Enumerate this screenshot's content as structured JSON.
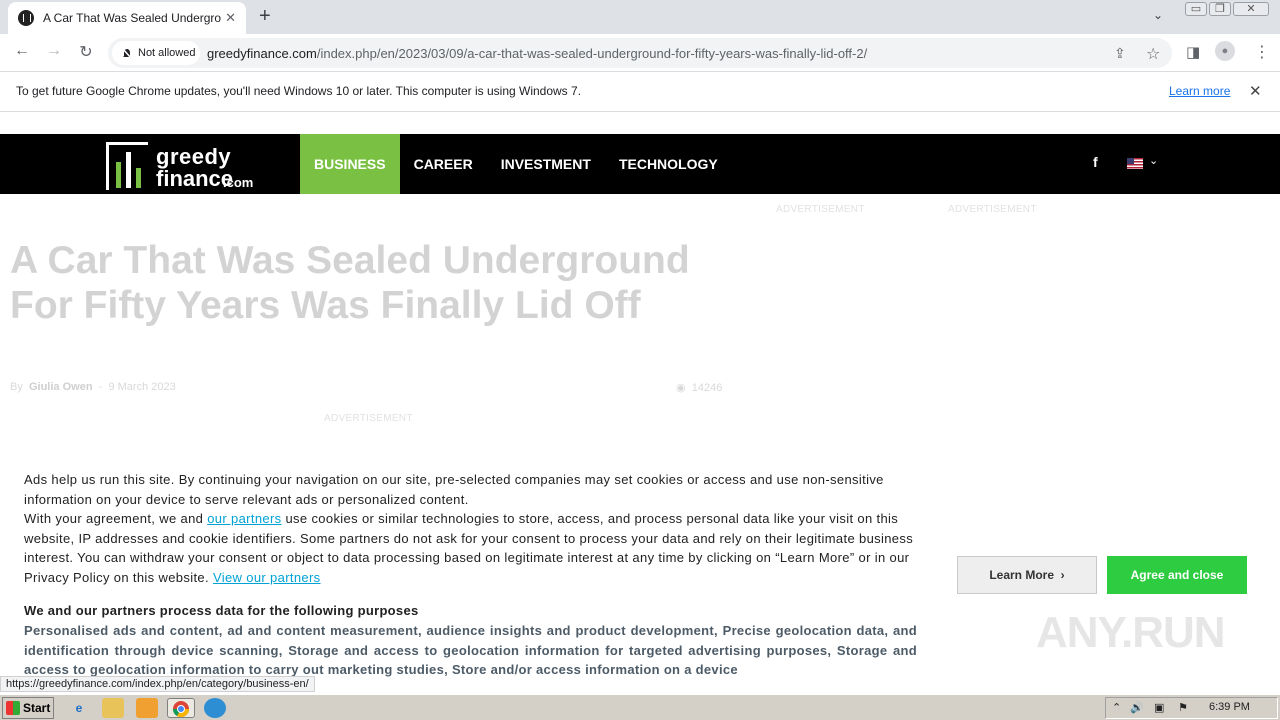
{
  "browser": {
    "tab": {
      "title": "A Car That Was Sealed Underground For Fifty Years Was Finally Lid Off",
      "close": "✕"
    },
    "new_tab": "+",
    "tab_search": "⌄",
    "window_controls": [
      "▭",
      "❐",
      "✕"
    ],
    "toolbar": {
      "back": "←",
      "forward": "→",
      "reload": "↻",
      "site_chip": "Not allowed",
      "url_host": "greedyfinance.com",
      "url_path": "/index.php/en/2023/03/09/a-car-that-was-sealed-underground-for-fifty-years-was-finally-lid-off-2/",
      "share": "⇪",
      "star": "☆",
      "sidepanel": "◨",
      "profile": "●",
      "menu": "⋮"
    },
    "infobar": {
      "message": "To get future Google Chrome updates, you'll need Windows 10 or later. This computer is using Windows 7.",
      "link": "Learn more",
      "close": "✕"
    },
    "status_url": "https://greedyfinance.com/index.php/en/category/business-en/"
  },
  "site": {
    "logo": {
      "line1": "greedy",
      "line2": "finance",
      "suffix": ".com"
    },
    "nav": [
      "BUSINESS",
      "CAREER",
      "INVESTMENT",
      "TECHNOLOGY"
    ],
    "facebook": "f",
    "lang_caret": "⌄"
  },
  "ads": {
    "label": "ADVERTISEMENT"
  },
  "article": {
    "title": "A Car That Was Sealed Underground For Fifty Years Was Finally Lid Off",
    "by": "By",
    "author": "Giulia Owen",
    "separator": "-",
    "date": "9 March 2023",
    "views_icon": "◉",
    "views": "14246"
  },
  "consent": {
    "para1": "Ads help us run this site. By continuing your navigation on our site, pre-selected companies may set cookies or access and use non-sensitive information on your device to serve relevant ads or personalized content.",
    "para2_a": "With your agreement, we and ",
    "para2_link": "our partners",
    "para2_b": " use cookies or similar technologies to store, access, and process personal data like your visit on this website, IP addresses and cookie identifiers. Some partners do not ask for your consent to process your data and rely on their legitimate business interest. You can withdraw your consent or object to data processing based on legitimate interest at any time by clicking on “Learn More” or in our Privacy Policy on this website. ",
    "para2_link2": "View our partners",
    "heading": "We and our partners process data for the following purposes",
    "purposes": "Personalised ads and content, ad and content measurement, audience insights and product development, Precise geolocation data, and identification through device scanning, Storage and access to geolocation information for targeted advertising purposes, Storage and access to geolocation information to carry out marketing studies, Store and/or access information on a device",
    "learn_more": "Learn More",
    "learn_more_arrow": "›",
    "agree": "Agree and close",
    "watermark": "ANY.RUN"
  },
  "taskbar": {
    "start": "Start",
    "clock": "6:39 PM",
    "tray_icons": [
      "⌃",
      "🔊",
      "▣",
      "⚑"
    ]
  },
  "colors": {
    "accent_green": "#7ac143",
    "agree_green": "#2ecc40",
    "link_blue": "#00a2d6"
  }
}
